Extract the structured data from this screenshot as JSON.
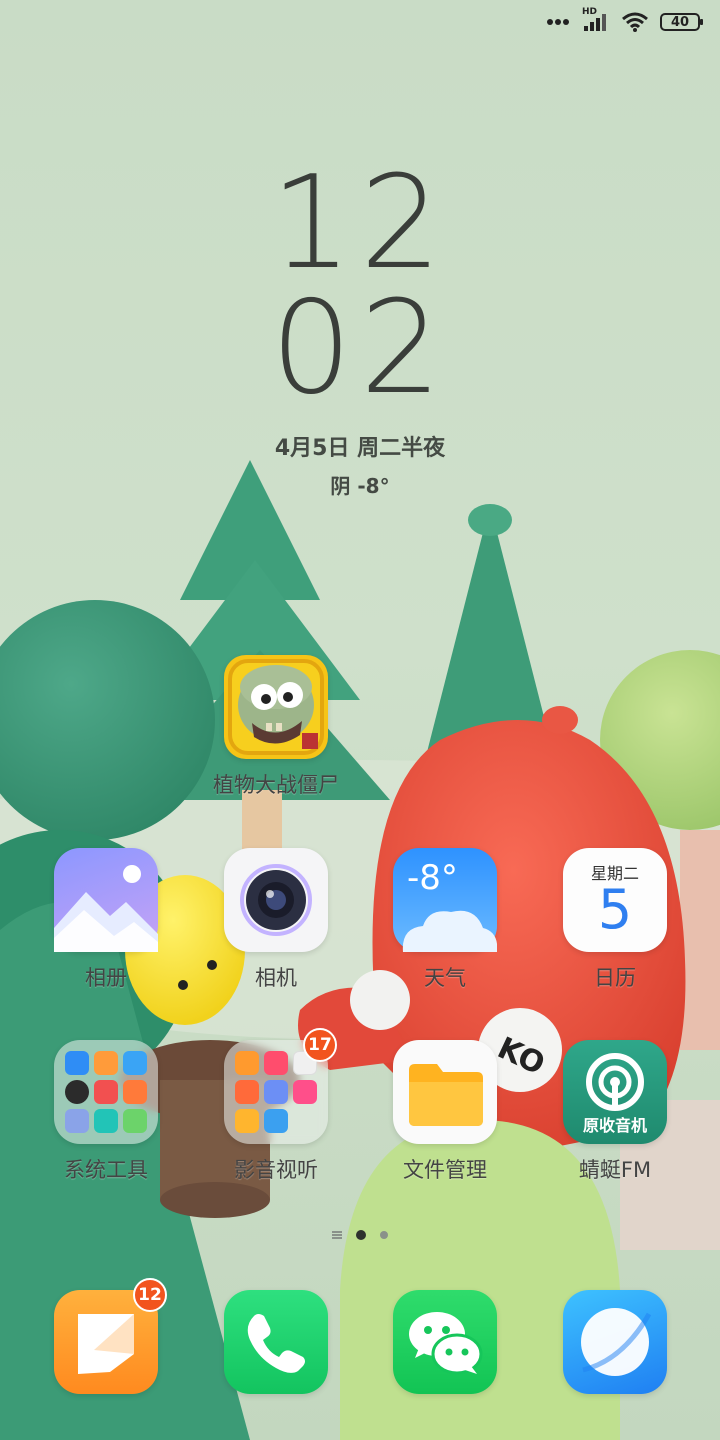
{
  "status_bar": {
    "network": "HD",
    "battery": "40",
    "icons": [
      "more-dots-icon",
      "signal-icon",
      "wifi-icon",
      "battery-icon"
    ]
  },
  "clock": {
    "hour": "12",
    "minute": "02"
  },
  "date": "4月5日 周二半夜",
  "weather": "阴  -8°",
  "apps": {
    "pvz": {
      "label": "植物大战僵尸"
    },
    "gallery": {
      "label": "相册"
    },
    "camera": {
      "label": "相机"
    },
    "weather": {
      "label": "天气",
      "temp": "-8°"
    },
    "calendar": {
      "label": "日历",
      "weekday": "星期二",
      "day": "5"
    },
    "system_tools": {
      "label": "系统工具"
    },
    "media": {
      "label": "影音视听",
      "badge": "17"
    },
    "files": {
      "label": "文件管理"
    },
    "radio": {
      "label": "蜻蜓FM",
      "icon_text": "原收音机"
    }
  },
  "dock": {
    "messages": {
      "badge": "12"
    },
    "phone": {},
    "wechat": {},
    "browser": {}
  },
  "pager": {
    "pages": 2,
    "active": 1
  },
  "colors": {
    "wallpaper_bg": "#cfe0cc",
    "badge": "#f2541e",
    "phone_green": "#1fd36b",
    "browser_blue": "#2a8ff5"
  }
}
